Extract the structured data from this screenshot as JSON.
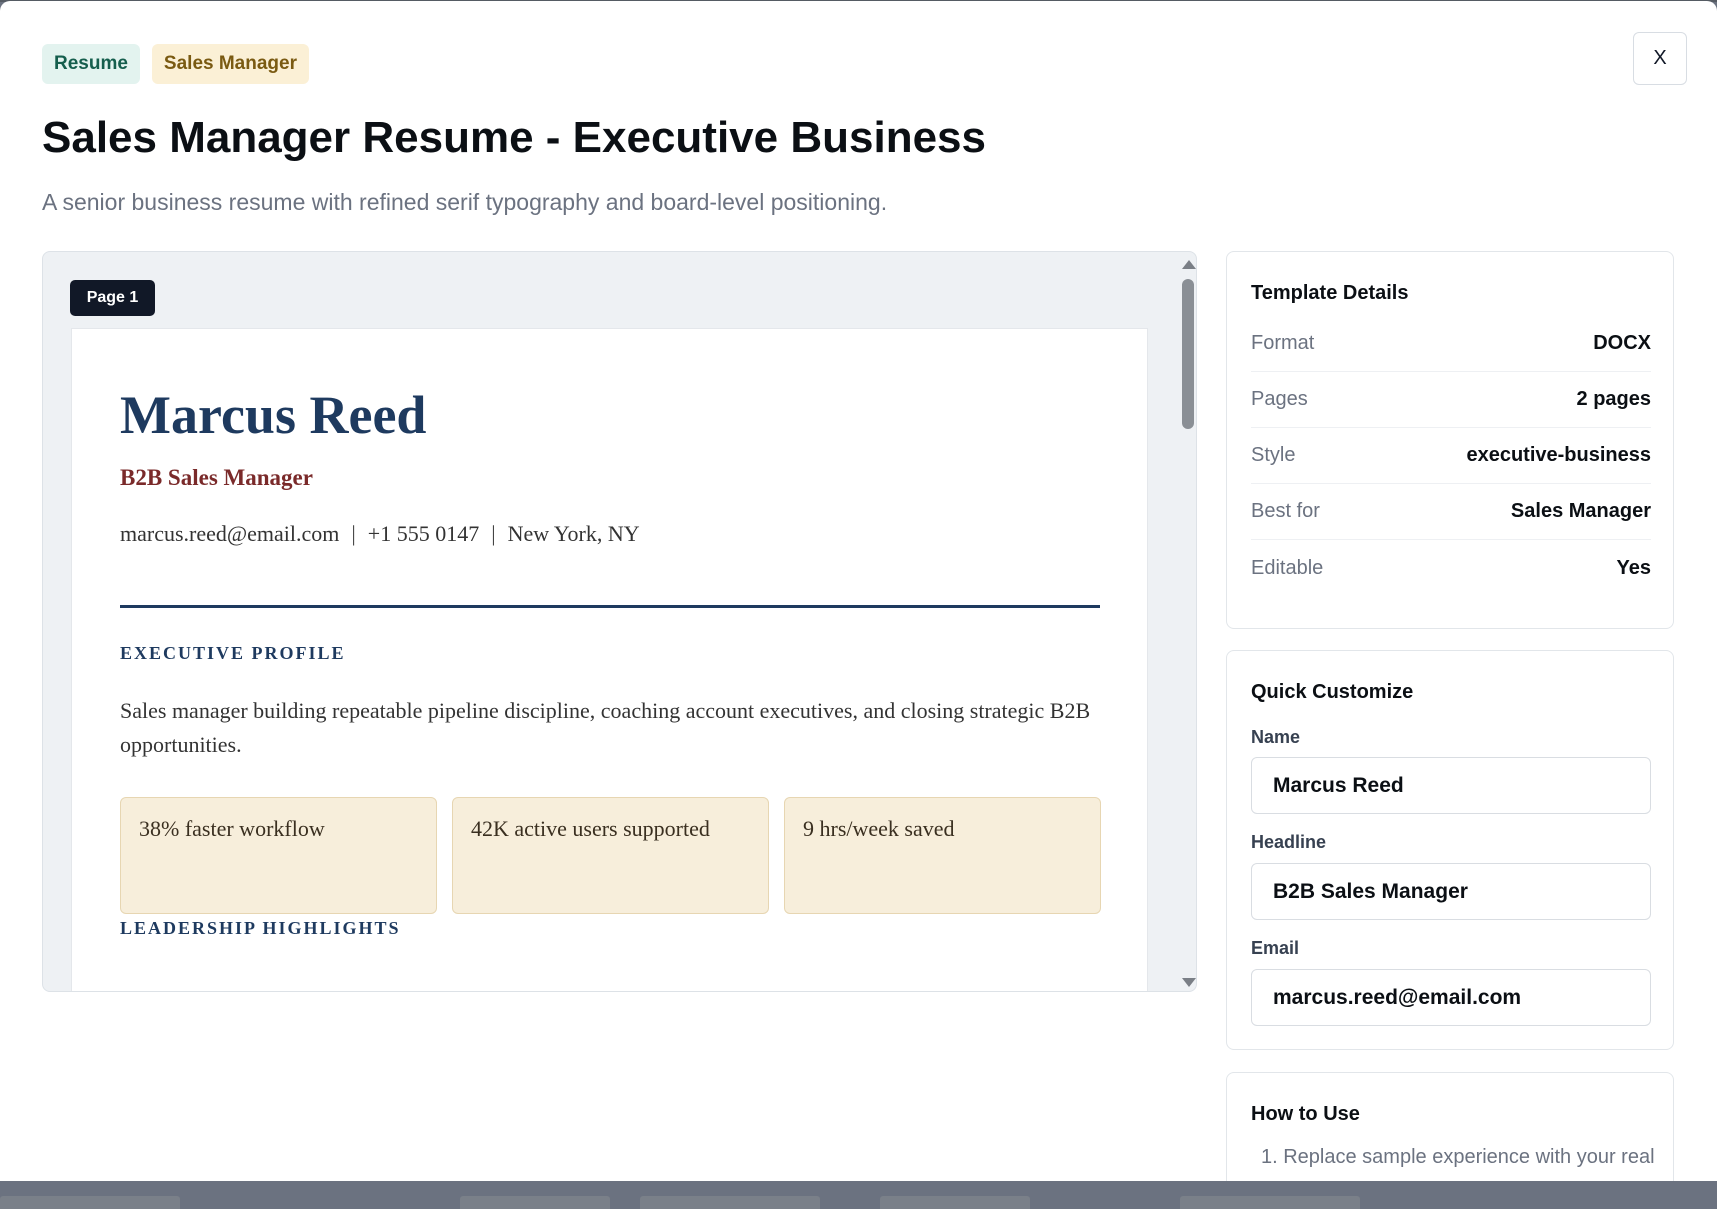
{
  "tags": {
    "type": "Resume",
    "role": "Sales Manager"
  },
  "close_label": "X",
  "title": "Sales Manager Resume - Executive Business",
  "subtitle": "A senior business resume with refined serif typography and board-level positioning.",
  "preview": {
    "page_label": "Page 1",
    "resume": {
      "name": "Marcus Reed",
      "headline": "B2B Sales Manager",
      "email": "marcus.reed@email.com",
      "phone": "+1 555 0147",
      "location": "New York, NY",
      "separator": "|",
      "sections": {
        "profile": "EXECUTIVE PROFILE",
        "highlights": "LEADERSHIP HIGHLIGHTS"
      },
      "profile_text": "Sales manager building repeatable pipeline discipline, coaching account executives, and closing strategic B2B opportunities.",
      "metrics": [
        "38% faster workflow",
        "42K active users supported",
        "9 hrs/week saved"
      ]
    }
  },
  "details": {
    "heading": "Template Details",
    "rows": [
      {
        "label": "Format",
        "value": "DOCX"
      },
      {
        "label": "Pages",
        "value": "2 pages"
      },
      {
        "label": "Style",
        "value": "executive-business"
      },
      {
        "label": "Best for",
        "value": "Sales Manager"
      },
      {
        "label": "Editable",
        "value": "Yes"
      }
    ]
  },
  "customize": {
    "heading": "Quick Customize",
    "name_label": "Name",
    "name_value": "Marcus Reed",
    "headline_label": "Headline",
    "headline_value": "B2B Sales Manager",
    "email_label": "Email",
    "email_value": "marcus.reed@email.com"
  },
  "howto": {
    "heading": "How to Use",
    "step1": "1. Replace sample experience with your real"
  },
  "colors": {
    "resume_accent": "#1e3a5f",
    "headline_accent": "#7a2a2a",
    "metric_bg": "#f7eedb",
    "tag_resume_bg": "#e3f3ef",
    "tag_role_bg": "#fbf0d6"
  }
}
